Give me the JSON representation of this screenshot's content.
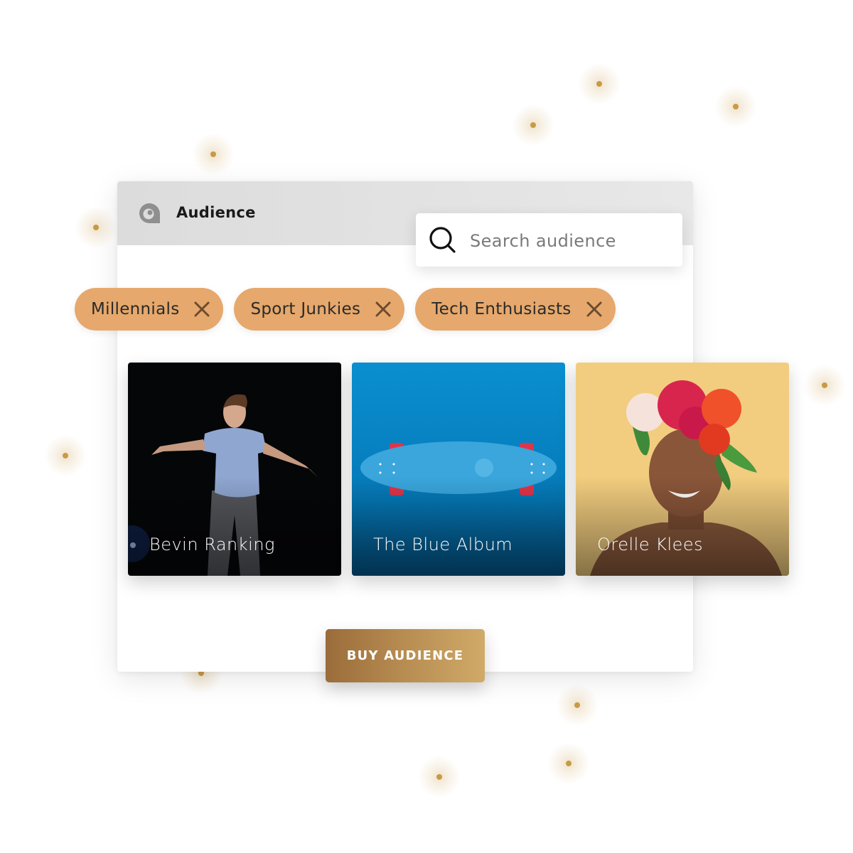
{
  "app": {
    "title": "Audience",
    "logo_icon": "audience-logo-icon"
  },
  "search": {
    "placeholder": "Search audience",
    "value": "",
    "icon": "search-icon"
  },
  "tags": [
    {
      "label": "Millennials",
      "remove_icon": "close-icon"
    },
    {
      "label": "Sport Junkies",
      "remove_icon": "close-icon"
    },
    {
      "label": "Tech Enthusiasts",
      "remove_icon": "close-icon"
    }
  ],
  "cards": [
    {
      "label": "Bevin Ranking",
      "image": "dancer-photo"
    },
    {
      "label": "The Blue Album",
      "image": "skateboard-photo"
    },
    {
      "label": "Orelle Klees",
      "image": "flower-crown-portrait"
    }
  ],
  "actions": {
    "buy_label": "BUY AUDIENCE"
  },
  "colors": {
    "tag_bg": "#e6a86c",
    "accent_gold": "#c99a45",
    "button_gradient_start": "#9a6c3a",
    "button_gradient_end": "#d0aa68",
    "header_bg": "#dcdcdc"
  }
}
